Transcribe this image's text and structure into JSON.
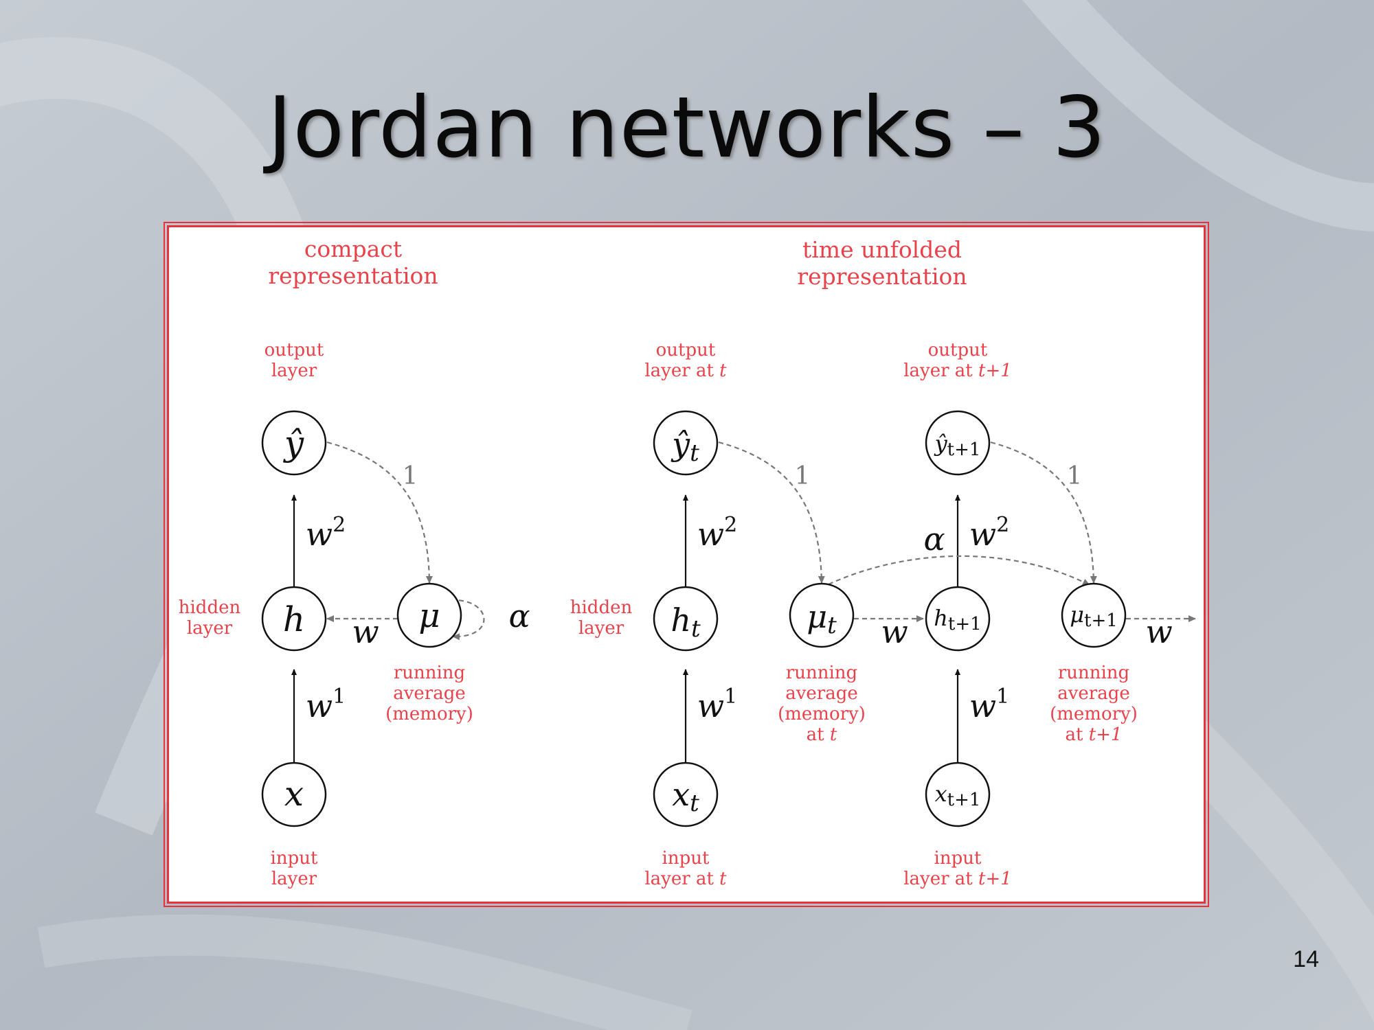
{
  "slide": {
    "title": "Jordan networks – 3",
    "page_number": "14"
  },
  "compact": {
    "header_line1": "compact",
    "header_line2": "representation",
    "output_label_line1": "output",
    "output_label_line2": "layer",
    "hidden_label_line1": "hidden",
    "hidden_label_line2": "layer",
    "input_label_line1": "input",
    "input_label_line2": "layer",
    "memory_label_line1": "running",
    "memory_label_line2": "average",
    "memory_label_line3": "(memory)",
    "node_y": "ŷ",
    "node_h": "h",
    "node_x": "x",
    "node_mu": "μ",
    "w2_base": "w",
    "w2_exp": "2",
    "w1_base": "w",
    "w1_exp": "1",
    "w": "w",
    "one": "1",
    "alpha": "α"
  },
  "unfolded": {
    "header_line1": "time unfolded",
    "header_line2": "representation",
    "output_t_line1": "output",
    "output_t_line2_a": "layer at ",
    "output_t_line2_b": "t",
    "output_t1_line1": "output",
    "output_t1_line2_a": "layer at ",
    "output_t1_line2_b": "t+1",
    "hidden_label_line1": "hidden",
    "hidden_label_line2": "layer",
    "input_t_line1": "input",
    "input_t_line2_a": "layer at ",
    "input_t_line2_b": "t",
    "input_t1_line1": "input",
    "input_t1_line2_a": "layer at ",
    "input_t1_line2_b": "t+1",
    "memory_t_line1": "running",
    "memory_t_line2": "average",
    "memory_t_line3": "(memory)",
    "memory_t_line4_a": "at ",
    "memory_t_line4_b": "t",
    "memory_t1_line1": "running",
    "memory_t1_line2": "average",
    "memory_t1_line3": "(memory)",
    "memory_t1_line4_a": "at ",
    "memory_t1_line4_b": "t+1",
    "node_y_base": "ŷ",
    "node_h_base": "h",
    "node_x_base": "x",
    "node_mu_base": "μ",
    "sub_t": "t",
    "sub_t1": "t+1",
    "w2_base": "w",
    "w2_exp": "2",
    "w1_base": "w",
    "w1_exp": "1",
    "w": "w",
    "one": "1",
    "alpha": "α"
  },
  "colors": {
    "label_red": "#e8434b",
    "frame_red": "#e8313a",
    "dashed_gray": "#777777"
  }
}
